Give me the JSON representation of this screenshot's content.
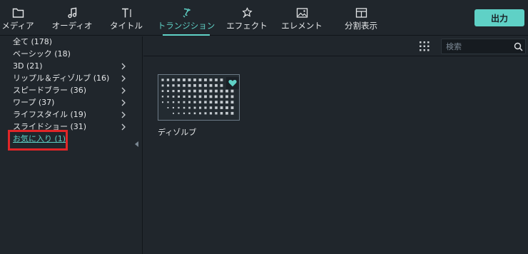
{
  "toolbar": {
    "tabs": [
      {
        "label": "メディア",
        "icon": "folder-icon"
      },
      {
        "label": "オーディオ",
        "icon": "music-note-icon"
      },
      {
        "label": "タイトル",
        "icon": "text-icon"
      },
      {
        "label": "トランジション",
        "icon": "transition-icon",
        "active": true
      },
      {
        "label": "エフェクト",
        "icon": "effect-icon"
      },
      {
        "label": "エレメント",
        "icon": "image-icon"
      },
      {
        "label": "分割表示",
        "icon": "split-screen-icon"
      }
    ],
    "export_label": "出力"
  },
  "sidebar": {
    "categories": [
      {
        "label": "全て (178)",
        "has_children": false
      },
      {
        "label": "ベーシック (18)",
        "has_children": false
      },
      {
        "label": "3D (21)",
        "has_children": true
      },
      {
        "label": "リップル＆ディゾルブ (16)",
        "has_children": true
      },
      {
        "label": "スピードブラー (36)",
        "has_children": true
      },
      {
        "label": "ワープ (37)",
        "has_children": true
      },
      {
        "label": "ライフスタイル (19)",
        "has_children": true
      },
      {
        "label": "スライドショー (31)",
        "has_children": true
      },
      {
        "label": "お気に入り (1)",
        "has_children": false,
        "selected": true
      }
    ]
  },
  "search": {
    "placeholder": "検索"
  },
  "items": [
    {
      "label": "ディゾルブ",
      "favorite": true
    }
  ],
  "colors": {
    "accent": "#5fd1c6",
    "background": "#20262c",
    "highlight_box": "#e02628"
  }
}
